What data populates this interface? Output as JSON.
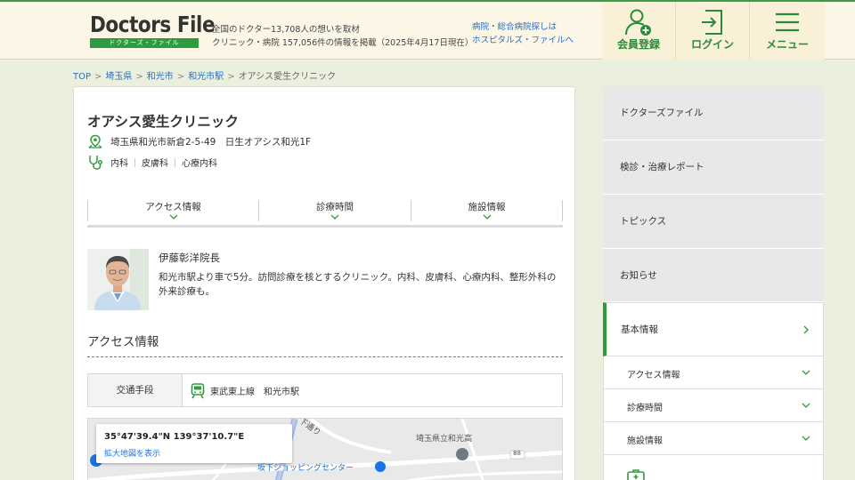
{
  "header": {
    "logo_main": "Doctors File",
    "logo_sub": "ドクターズ・ファイル",
    "tagline_line1": "全国のドクター13,708人の想いを取材",
    "tagline_line2": "クリニック・病院 157,056件の情報を掲載（2025年4月17日現在）",
    "hospital_link_line1": "病院・総合病院探しは",
    "hospital_link_line2": "ホスピタルズ・ファイルへ",
    "register_label": "会員登録",
    "login_label": "ログイン",
    "menu_label": "メニュー"
  },
  "breadcrumb": [
    "TOP",
    "埼玉県",
    "和光市",
    "和光市駅",
    "オアシス愛生クリニック"
  ],
  "clinic": {
    "name": "オアシス愛生クリニック",
    "address": "埼玉県和光市新倉2-5-49　日生オアシス和光1F",
    "departments": [
      "内科",
      "皮膚科",
      "心療内科"
    ]
  },
  "tabs": [
    "アクセス情報",
    "診療時間",
    "施設情報"
  ],
  "doctor": {
    "name": "伊藤彰洋院長",
    "description": "和光市駅より車で5分。訪問診療を核とするクリニック。内科、皮膚科、心療内科、整形外科の外来診療も。"
  },
  "access": {
    "section_title": "アクセス情報",
    "transport_label": "交通手段",
    "transport_value": "東武東上線　和光市駅"
  },
  "map": {
    "coords": "35°47'39.4\"N 139°37'10.7\"E",
    "enlarge_label": "拡大地図を表示",
    "labels": [
      "埼玉県立和光高",
      "坂下ショッピングセンター",
      "下通り",
      "88"
    ]
  },
  "sidebar": {
    "items": [
      "ドクターズファイル",
      "検診・治療レポート",
      "トピックス",
      "お知らせ"
    ],
    "active": "基本情報",
    "subitems": [
      "アクセス情報",
      "診療時間",
      "施設情報"
    ]
  },
  "colors": {
    "brand_green": "#2e9b3e",
    "link_blue": "#2a6fc4",
    "header_bg": "#fbf6e6",
    "page_bg": "#eaf0dd"
  }
}
